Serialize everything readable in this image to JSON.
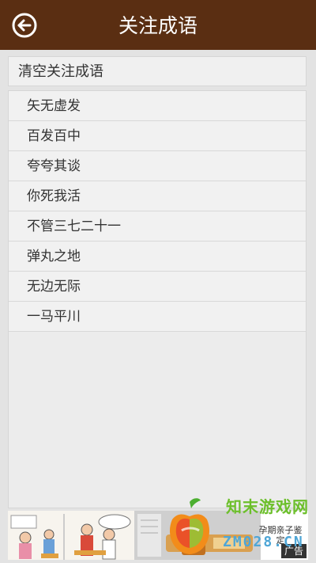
{
  "header": {
    "title": "关注成语",
    "back_icon": "back-arrow-circle-icon"
  },
  "clear_action": {
    "label": "清空关注成语"
  },
  "idioms": [
    "矢无虚发",
    "百发百中",
    "夸夸其谈",
    "你死我活",
    "不管三七二十一",
    "弹丸之地",
    "无边无际",
    "一马平川"
  ],
  "ad": {
    "text": "孕期亲子鉴定",
    "tag": "广告"
  },
  "watermark": {
    "title": "知末游戏网",
    "subtitle": "ZM028.CN"
  },
  "colors": {
    "header_bg": "#5a2e12",
    "page_bg": "#e3e3e3",
    "row_bg": "#f1f1f1",
    "watermark_green": "#6cbf2b",
    "watermark_blue": "#4fa6d6"
  }
}
